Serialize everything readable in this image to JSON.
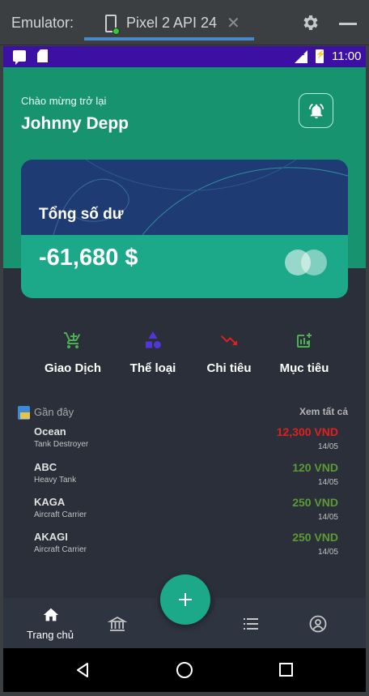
{
  "emulator": {
    "label": "Emulator:",
    "tab_name": "Pixel 2 API 24",
    "close_glyph": "✕",
    "icons": [
      "phone-device-icon",
      "close-icon",
      "gear-icon",
      "minimize-icon"
    ]
  },
  "status_bar": {
    "time": "11:00",
    "network": "LTE",
    "color": "#3c10a3"
  },
  "header": {
    "greeting": "Chào mừng trở lại",
    "user_name": "Johnny Depp"
  },
  "balance_card": {
    "label": "Tổng số dư",
    "amount": "-61,680 $"
  },
  "actions": [
    {
      "label": "Giao Dịch",
      "icon": "cart-icon",
      "color": "#4caf50"
    },
    {
      "label": "Thể loại",
      "icon": "shapes-icon",
      "color": "#5236d9"
    },
    {
      "label": "Chi tiêu",
      "icon": "trending-down-icon",
      "color": "#e0201e"
    },
    {
      "label": "Mục tiêu",
      "icon": "chart-add-icon",
      "color": "#4caf50"
    }
  ],
  "recent": {
    "title": "Gần đây",
    "see_all": "Xem tất cả",
    "transactions": [
      {
        "name": "Ocean",
        "type": "Tank Destroyer",
        "amount": "12,300 VND",
        "date": "14/05",
        "color": "#e0201e"
      },
      {
        "name": "ABC",
        "type": "Heavy Tank",
        "amount": "120 VND",
        "date": "14/05",
        "color": "#5b9a35"
      },
      {
        "name": "KAGA",
        "type": "Aircraft Carrier",
        "amount": "250 VND",
        "date": "14/05",
        "color": "#5b9a35"
      },
      {
        "name": "AKAGI",
        "type": "Aircraft Carrier",
        "amount": "250 VND",
        "date": "14/05",
        "color": "#5b9a35"
      }
    ]
  },
  "bottom_nav": {
    "home_label": "Trang chủ",
    "fab_icon": "plus-icon",
    "items": [
      "home-icon",
      "bank-icon",
      "list-icon",
      "account-icon"
    ]
  },
  "colors": {
    "primary": "#18936f",
    "card_dark": "#1e3b73",
    "card_light": "#1ba98a",
    "background": "#2b2f3a"
  }
}
